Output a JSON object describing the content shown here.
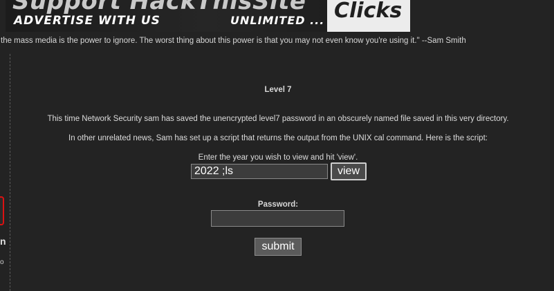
{
  "banner": {
    "headline": "Support HackThisSite",
    "advertise": "ADVERTISE WITH US",
    "unlimited": "UNLIMITED ...",
    "clicks": "Clicks"
  },
  "quote": "the mass media is the power to ignore. The worst thing about this power is that you may not even know you're using it.\" --Sam Smith",
  "sidebar": {
    "fragment_n": "n",
    "fragment_o": "o"
  },
  "challenge": {
    "title": "Level 7",
    "description_1": "This time Network Security sam has saved the unencrypted level7 password in an obscurely named file saved in this very directory.",
    "description_2": "In other unrelated news, Sam has set up a script that returns the output from the UNIX cal command. Here is the script:",
    "year_prompt": "Enter the year you wish to view and hit 'view'.",
    "year_value": "2022 ;ls",
    "view_label": "view",
    "password_label": "Password:",
    "password_value": "",
    "submit_label": "submit"
  },
  "colors": {
    "background": "#232323",
    "text": "#dcdcdc",
    "side_red": "#dd1111"
  }
}
